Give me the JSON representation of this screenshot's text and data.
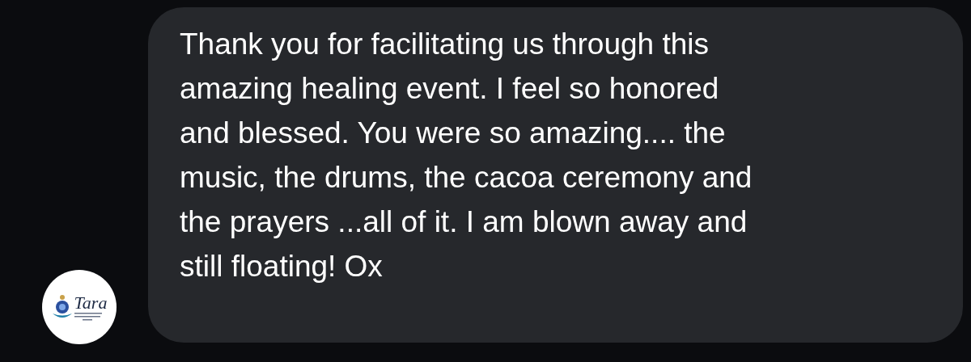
{
  "message": {
    "avatar": {
      "logo_text": "Tara"
    },
    "text": "Thank you for facilitating us through this\namazing healing event. I feel so honored\nand blessed. You were so amazing.... the\nmusic, the drums, the cacoa ceremony and\nthe prayers ...all of it. I am blown away and\nstill floating! Ox"
  }
}
